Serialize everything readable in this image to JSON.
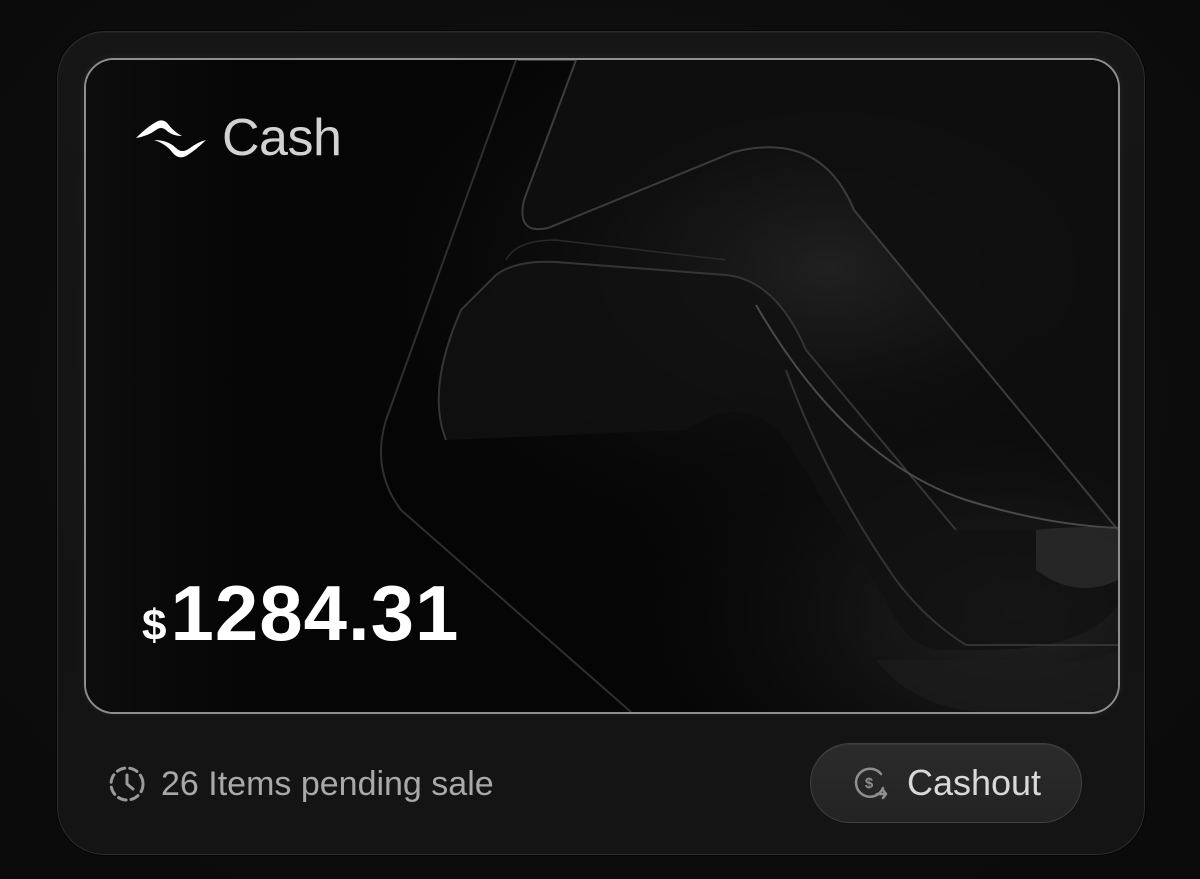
{
  "brand": {
    "name": "Cash",
    "logo_icon": "wave-logo-icon"
  },
  "balance": {
    "currency_symbol": "$",
    "amount": "1284.31"
  },
  "pending": {
    "icon": "clock-dashed-icon",
    "text": "26 Items pending sale"
  },
  "cashout": {
    "label": "Cashout",
    "icon": "dollar-exchange-icon"
  },
  "colors": {
    "page_background": "#0c0c0c",
    "panel_background": "#141414",
    "card_background": "#050505",
    "text_primary": "#ffffff",
    "text_secondary": "#a9a9a9"
  }
}
